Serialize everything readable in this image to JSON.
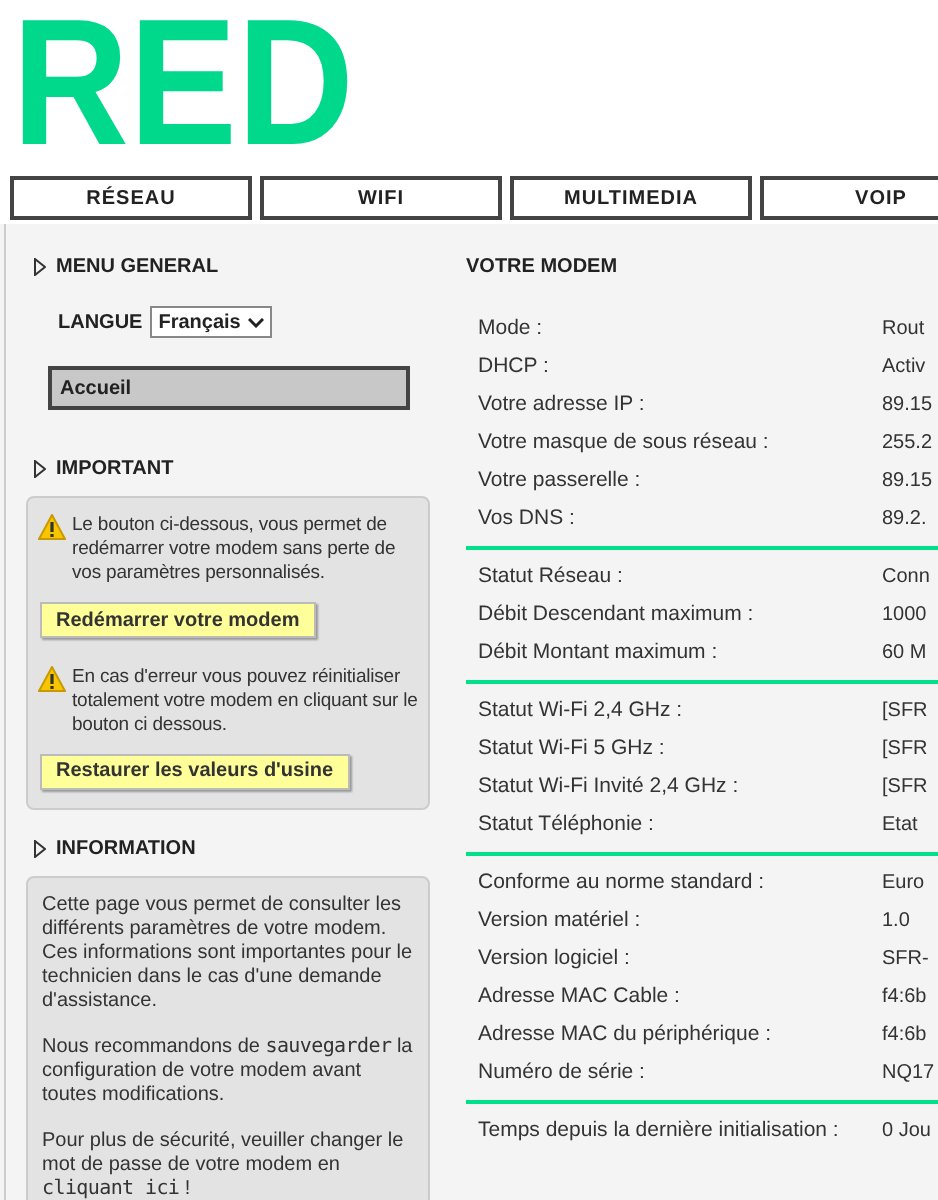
{
  "logo": {
    "text": "RED"
  },
  "tabs": [
    {
      "label": "RÉSEAU"
    },
    {
      "label": "WIFI"
    },
    {
      "label": "MULTIMEDIA"
    },
    {
      "label": "VOIP"
    }
  ],
  "sidebar": {
    "menu_general": {
      "title": "MENU GENERAL",
      "language_label": "LANGUE",
      "language_value": "Français",
      "items": [
        {
          "label": "Accueil",
          "selected": true
        }
      ]
    },
    "important": {
      "title": "IMPORTANT",
      "notes": [
        {
          "text": "Le bouton ci-dessous, vous permet de redémarrer votre modem sans perte de vos paramètres personnalisés.",
          "button": "Redémarrer votre modem"
        },
        {
          "text": "En cas d'erreur vous pouvez réinitialiser totalement votre modem en cliquant sur le bouton ci dessous.",
          "button": "Restaurer les valeurs d'usine"
        }
      ]
    },
    "information": {
      "title": "INFORMATION",
      "paragraphs": [
        [
          {
            "kind": "text",
            "text": "Cette page vous permet de consulter les différents paramètres de votre modem. Ces informations sont importantes pour le technicien dans le cas d'une demande d'assistance."
          }
        ],
        [
          {
            "kind": "text",
            "text": "Nous recommandons de "
          },
          {
            "kind": "link",
            "text": "sauvegarder"
          },
          {
            "kind": "text",
            "text": " la configuration de votre modem avant toutes modifications."
          }
        ],
        [
          {
            "kind": "text",
            "text": "Pour plus de sécurité, veuiller changer le mot de passe de votre modem en "
          },
          {
            "kind": "link",
            "text": "cliquant ici"
          },
          {
            "kind": "text",
            "text": " !"
          }
        ]
      ]
    }
  },
  "main": {
    "title": "VOTRE MODEM",
    "groups": [
      [
        {
          "label": "Mode :",
          "value": "Rout"
        },
        {
          "label": "DHCP :",
          "value": "Activ"
        },
        {
          "label": "Votre adresse IP :",
          "value": "89.15"
        },
        {
          "label": "Votre masque de sous réseau :",
          "value": "255.2"
        },
        {
          "label": "Votre passerelle :",
          "value": "89.15"
        },
        {
          "label": "Vos DNS :",
          "value": "89.2."
        }
      ],
      [
        {
          "label": "Statut Réseau :",
          "value": "Conn"
        },
        {
          "label": "Débit Descendant maximum :",
          "value": "1000"
        },
        {
          "label": "Débit Montant maximum :",
          "value": "60 M"
        }
      ],
      [
        {
          "label": "Statut Wi-Fi 2,4 GHz :",
          "value": "[SFR"
        },
        {
          "label": "Statut Wi-Fi 5 GHz :",
          "value": "[SFR"
        },
        {
          "label": "Statut Wi-Fi Invité 2,4 GHz :",
          "value": "[SFR"
        },
        {
          "label": "Statut Téléphonie :",
          "value": "Etat"
        }
      ],
      [
        {
          "label": "Conforme au norme standard :",
          "value": "Euro"
        },
        {
          "label": "Version matériel :",
          "value": "1.0"
        },
        {
          "label": "Version logiciel :",
          "value": "SFR-"
        },
        {
          "label": "Adresse MAC Cable :",
          "value": "f4:6b"
        },
        {
          "label": "Adresse MAC du périphérique :",
          "value": "f4:6b"
        },
        {
          "label": "Numéro de série :",
          "value": "NQ17"
        }
      ],
      [
        {
          "label": "Temps depuis la dernière initialisation :",
          "value": "0 Jou"
        }
      ]
    ]
  }
}
